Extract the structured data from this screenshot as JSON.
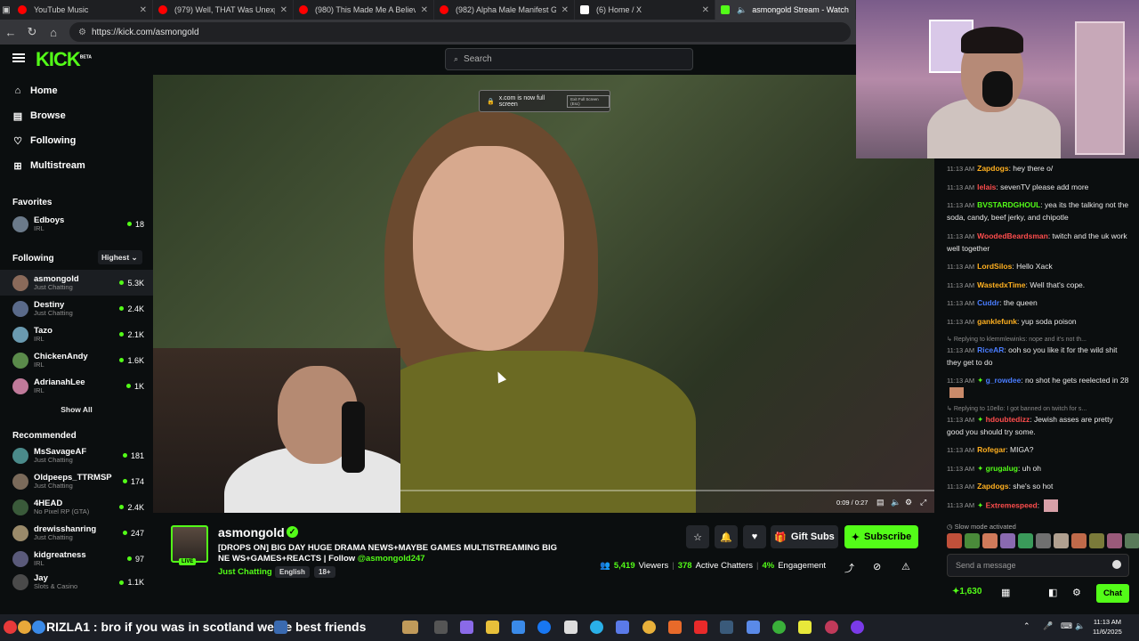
{
  "browser": {
    "tabs": [
      {
        "title": "YouTube Music",
        "color": "#ff0000"
      },
      {
        "title": "(979) Well, THAT Was Unexpected",
        "color": "#ff0000"
      },
      {
        "title": "(980) This Made Me A Believer in",
        "color": "#ff0000"
      },
      {
        "title": "(982) Alpha Male Manifest Guru",
        "color": "#ff0000"
      },
      {
        "title": "(6) Home / X",
        "color": "#ffffff"
      },
      {
        "title": "asmongold Stream - Watch",
        "color": "#53fc18"
      }
    ],
    "url": "https://kick.com/asmongold"
  },
  "header": {
    "logo": "KICK",
    "logo_badge": "BETA",
    "search_placeholder": "Search"
  },
  "sidebar": {
    "nav": [
      {
        "label": "Home",
        "icon": "home-icon"
      },
      {
        "label": "Browse",
        "icon": "browse-icon"
      },
      {
        "label": "Following",
        "icon": "heart-icon"
      },
      {
        "label": "Multistream",
        "icon": "grid-icon"
      }
    ],
    "favorites_title": "Favorites",
    "favorites": [
      {
        "name": "Edboys",
        "category": "IRL",
        "viewers": "18"
      }
    ],
    "following_title": "Following",
    "sort_label": "Highest",
    "following": [
      {
        "name": "asmongold",
        "category": "Just Chatting",
        "viewers": "5.3K"
      },
      {
        "name": "Destiny",
        "category": "Just Chatting",
        "viewers": "2.4K"
      },
      {
        "name": "Tazo",
        "category": "IRL",
        "viewers": "2.1K"
      },
      {
        "name": "ChickenAndy",
        "category": "IRL",
        "viewers": "1.6K"
      },
      {
        "name": "AdrianahLee",
        "category": "IRL",
        "viewers": "1K"
      }
    ],
    "show_all": "Show All",
    "recommended_title": "Recommended",
    "recommended": [
      {
        "name": "MsSavageAF",
        "category": "Just Chatting",
        "viewers": "181"
      },
      {
        "name": "Oldpeeps_TTRMSP",
        "category": "Just Chatting",
        "viewers": "174"
      },
      {
        "name": "4HEAD",
        "category": "No Pixel RP (GTA)",
        "viewers": "2.4K"
      },
      {
        "name": "drewisshanring",
        "category": "Just Chatting",
        "viewers": "247"
      },
      {
        "name": "kidgreatness",
        "category": "IRL",
        "viewers": "97"
      },
      {
        "name": "Jay",
        "category": "Slots & Casino",
        "viewers": "1.1K"
      }
    ]
  },
  "video": {
    "fullscreen_notice": "x.com is now full screen",
    "fullscreen_exit": "Exit Full Screen (Esc)",
    "timecode": "0:09 / 0:27",
    "progress": 0.0
  },
  "stream": {
    "streamer": "asmongold",
    "live_label": "LIVE",
    "title": "[DROPS ON] BIG DAY HUGE DRAMA NEWS+MAYBE GAMES MULTISTREAMING BIG NE WS+GAMES+REACTS | Follow",
    "title_handle": "@asmongold247",
    "category": "Just Chatting",
    "tags": [
      "English",
      "18+"
    ],
    "gift_label": "Gift Subs",
    "subscribe_label": "Subscribe",
    "viewers": "5,419",
    "viewers_label": "Viewers",
    "chatters": "378",
    "chatters_label": "Active Chatters",
    "engagement": "4%",
    "engagement_label": "Engagement"
  },
  "chat": {
    "messages": [
      {
        "time": "11:13 AM",
        "user": "Zapdogs",
        "color": "#ffb020",
        "text": "hey there o/"
      },
      {
        "time": "11:13 AM",
        "user": "lelais",
        "color": "#ff4d4d",
        "text": "sevenTV please add more"
      },
      {
        "time": "11:13 AM",
        "user": "BVSTARDGHOUL",
        "color": "#53fc18",
        "text": "yea its the talking not the soda, candy, beef jerky, and chipotle"
      },
      {
        "time": "11:13 AM",
        "user": "WoodedBeardsman",
        "color": "#ff4d4d",
        "text": "twitch and the uk work well together"
      },
      {
        "time": "11:13 AM",
        "user": "LordSilos",
        "color": "#ffb020",
        "text": "Hello Xack"
      },
      {
        "time": "11:13 AM",
        "user": "WastedxTime",
        "color": "#ffb020",
        "text": "Well that's cope."
      },
      {
        "time": "11:13 AM",
        "user": "Cuddr",
        "color": "#4a7dff",
        "text": "the queen"
      },
      {
        "time": "11:13 AM",
        "user": "ganklefunk",
        "color": "#ffb020",
        "text": "yup soda poison"
      },
      {
        "time": "11:13 AM",
        "user": "RiceAR",
        "color": "#4a7dff",
        "text": "ooh so you like it for the wild shit they get to do"
      },
      {
        "time": "11:13 AM",
        "user": "g_rowdee",
        "color": "#4a7dff",
        "text": "no shot he gets reelected in 28"
      },
      {
        "time": "11:13 AM",
        "user": "hdoubtedizz",
        "color": "#ff4d4d",
        "text": "Jewish asses are pretty good you should try some."
      },
      {
        "time": "11:13 AM",
        "user": "Rofegar",
        "color": "#ffb020",
        "text": "MIGA?"
      },
      {
        "time": "11:13 AM",
        "user": "grugalug",
        "color": "#53fc18",
        "text": "uh oh"
      },
      {
        "time": "11:13 AM",
        "user": "Zapdogs",
        "color": "#ffb020",
        "text": "she's so hot"
      },
      {
        "time": "11:13 AM",
        "user": "Extremespeed",
        "color": "#ff4d4d",
        "text": ""
      }
    ],
    "replies": [
      "Replying to klemmlewinks: nope and it's not th...",
      "Replying to 10ello: I got banned on twitch for s..."
    ],
    "slow_mode": "Slow mode activated",
    "input_placeholder": "Send a message",
    "points": "1,630",
    "chat_button": "Chat"
  },
  "taskbar": {
    "subtitle": "RIZLA1 : bro if you was in scotland we be best friends",
    "time": "11:13 AM",
    "date": "11/6/2025"
  }
}
